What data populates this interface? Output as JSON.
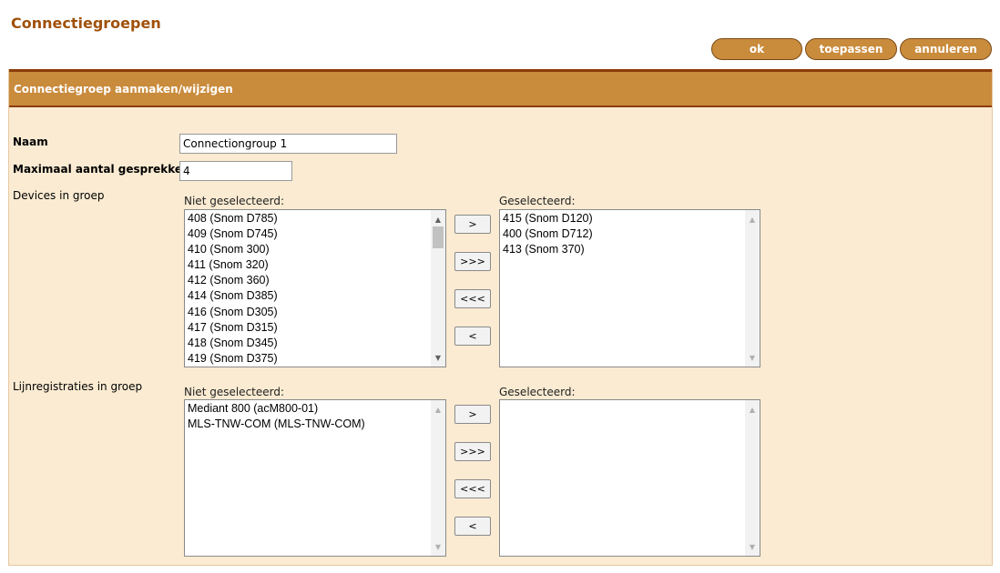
{
  "page": {
    "title": "Connectiegroepen"
  },
  "actions": {
    "ok": "ok",
    "apply": "toepassen",
    "cancel": "annuleren"
  },
  "form": {
    "header": "Connectiegroep aanmaken/wijzigen",
    "name_label": "Naam",
    "name_value": "Connectiongroup 1",
    "max_calls_label": "Maximaal aantal gesprekken",
    "max_calls_value": "4",
    "devices": {
      "label": "Devices in groep",
      "unselected_label": "Niet geselecteerd:",
      "selected_label": "Geselecteerd:",
      "unselected_items": [
        "408 (Snom D785)",
        "409 (Snom D745)",
        "410 (Snom 300)",
        "411 (Snom 320)",
        "412 (Snom 360)",
        "414 (Snom D385)",
        "416 (Snom D305)",
        "417 (Snom D315)",
        "418 (Snom D345)",
        "419 (Snom D375)"
      ],
      "selected_items": [
        "415 (Snom D120)",
        "400 (Snom D712)",
        "413 (Snom 370)"
      ]
    },
    "lines": {
      "label": "Lijnregistraties in groep",
      "unselected_label": "Niet geselecteerd:",
      "selected_label": "Geselecteerd:",
      "unselected_items": [
        "Mediant 800 (acM800-01)",
        "MLS-TNW-COM (MLS-TNW-COM)"
      ],
      "selected_items": []
    },
    "move_buttons": {
      "add": ">",
      "add_all": ">>>",
      "remove_all": "<<<",
      "remove": "<"
    }
  },
  "icons": {
    "scroll_up": "scroll-up-arrow-icon",
    "scroll_down": "scroll-down-arrow-icon"
  },
  "colors": {
    "title": "#a0510a",
    "accent": "#c98b3c",
    "accent_border": "#8a3c0a",
    "panel_bg": "#faebd2"
  }
}
